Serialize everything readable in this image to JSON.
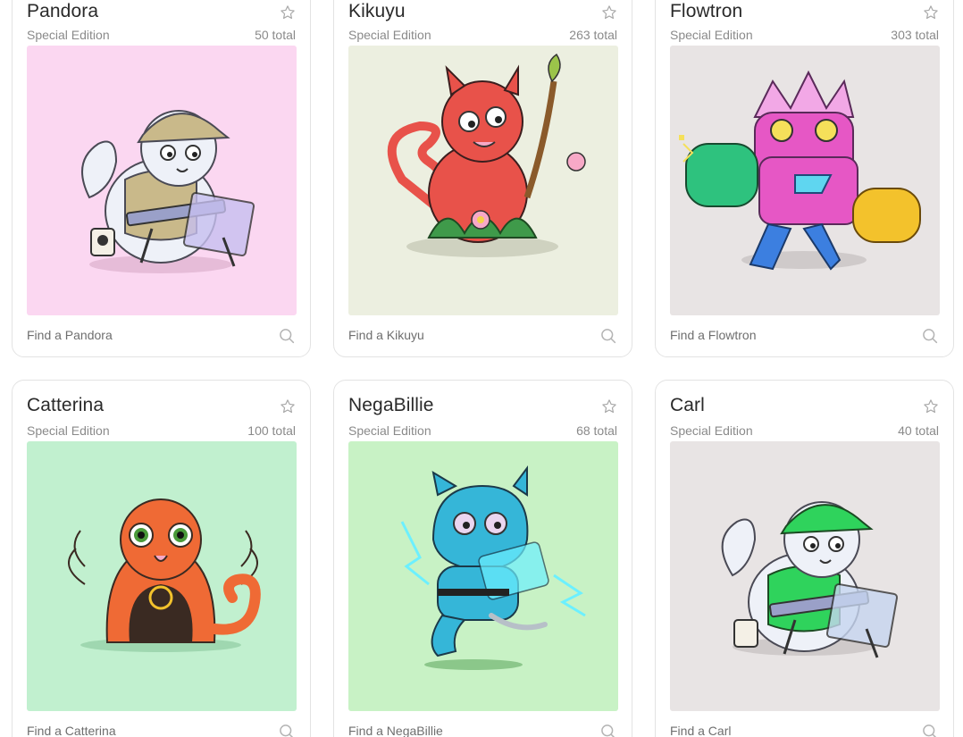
{
  "cards": [
    {
      "name": "Pandora",
      "edition": "Special Edition",
      "total": "50 total",
      "find": "Find a Pandora",
      "bg": "#fbd7f1",
      "cat_color": "#eef1f8",
      "accent": "#c9b98a"
    },
    {
      "name": "Kikuyu",
      "edition": "Special Edition",
      "total": "263 total",
      "find": "Find a Kikuyu",
      "bg": "#ecefe0",
      "cat_color": "#e8524a",
      "accent": "#f7a9c7"
    },
    {
      "name": "Flowtron",
      "edition": "Special Edition",
      "total": "303 total",
      "find": "Find a Flowtron",
      "bg": "#e8e4e4",
      "cat_color": "#e657c5",
      "accent": "#2ec27e"
    },
    {
      "name": "Catterina",
      "edition": "Special Edition",
      "total": "100 total",
      "find": "Find a Catterina",
      "bg": "#c1f0cf",
      "cat_color": "#ef6a35",
      "accent": "#3a2a22"
    },
    {
      "name": "NegaBillie",
      "edition": "Special Edition",
      "total": "68 total",
      "find": "Find a NegaBillie",
      "bg": "#c8f2c5",
      "cat_color": "#35b6d8",
      "accent": "#6cf0ff"
    },
    {
      "name": "Carl",
      "edition": "Special Edition",
      "total": "40 total",
      "find": "Find a Carl",
      "bg": "#e8e4e4",
      "cat_color": "#eef1f8",
      "accent": "#2fd35c"
    }
  ],
  "icons": {
    "favorite": "star-icon",
    "find": "search-icon"
  }
}
